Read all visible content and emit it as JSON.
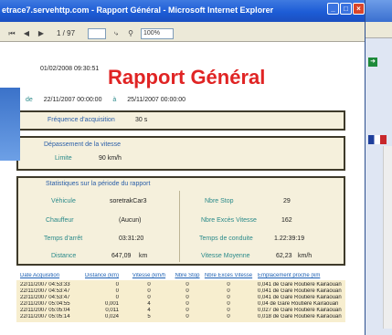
{
  "window": {
    "title": "etrace7.servehttp.com - Rapport Général - Microsoft Internet Explorer"
  },
  "toolbar": {
    "page": "1 / 97",
    "zoom": "100%"
  },
  "report": {
    "generated": "01/02/2008 09:30:51",
    "title": "Rapport Général",
    "period": {
      "from_label": "de",
      "from": "22/11/2007 00:00:00",
      "to_label": "à",
      "to": "25/11/2007 00:00:00"
    },
    "acquisition": {
      "label": "Fréquence d'acquisition",
      "value": "30 s"
    },
    "speed": {
      "title": "Dépassement de la vitesse",
      "limit_label": "Limite",
      "limit_value": "90 km/h"
    },
    "stats": {
      "title": "Statistiques sur la période du rapport",
      "vehicle_label": "Véhicule",
      "vehicle_value": "soretrakCar3",
      "driver_label": "Chauffeur",
      "driver_value": "(Aucun)",
      "stop_time_label": "Temps d'arrêt",
      "stop_time_value": "03:31:20",
      "distance_label": "Distance",
      "distance_value": "647,09",
      "distance_unit": "km",
      "stop_count_label": "Nbre Stop",
      "stop_count_value": "29",
      "speed_excess_label": "Nbre Excès Vitesse",
      "speed_excess_value": "162",
      "drive_time_label": "Temps de conduite",
      "drive_time_value": "1.22:39:19",
      "avg_speed_label": "Vitesse Moyenne",
      "avg_speed_value": "62,23",
      "avg_speed_unit": "km/h"
    }
  },
  "table": {
    "headers": [
      "Date Acquisition",
      "Distance (km)",
      "Vitesse (km/h",
      "Nbre Stop",
      "Nbre Excès Vitesse",
      "Emplacement proche (km"
    ],
    "rows": [
      [
        "22/11/2007 04:53:33",
        "0",
        "0",
        "0",
        "0",
        "0,041 de Gare Routière Kairaouan"
      ],
      [
        "22/11/2007 04:53:47",
        "0",
        "0",
        "0",
        "0",
        "0,041 de Gare Routière Kairaouan"
      ],
      [
        "22/11/2007 04:53:47",
        "0",
        "0",
        "0",
        "0",
        "0,041 de Gare Routière Kairaouan"
      ],
      [
        "22/11/2007 05:04:55",
        "0,001",
        "4",
        "0",
        "0",
        "0,04 de Gare Routière Kairaouan"
      ],
      [
        "22/11/2007 05:05:04",
        "0,011",
        "4",
        "0",
        "0",
        "0,027 de Gare Routière Kairaouan"
      ],
      [
        "22/11/2007 05:05:14",
        "0,024",
        "5",
        "0",
        "0",
        "0,018 de Gare Routière Kairaouan"
      ]
    ]
  },
  "colors": {
    "title_red": "#e02424",
    "label_teal": "#2a8a8a",
    "section_blue": "#2a5ea8",
    "box_bg": "#f5f0dc"
  }
}
